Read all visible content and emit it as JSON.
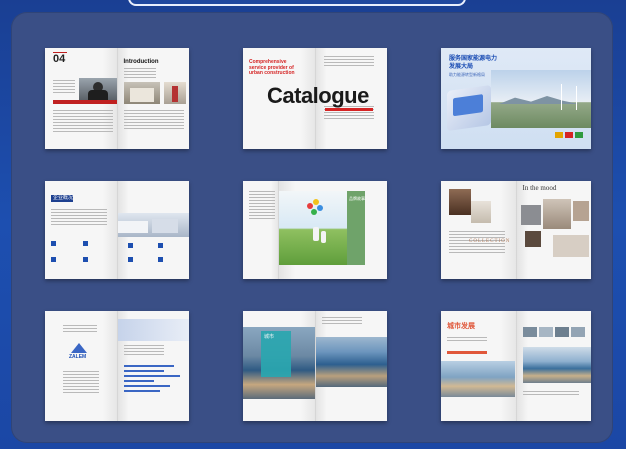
{
  "books": [
    {
      "id": "intro",
      "chapter_number": "04",
      "title": "Introduction"
    },
    {
      "id": "catalogue",
      "tagline": "Comprehensive service provider of urban construction",
      "title": "Catalogue"
    },
    {
      "id": "energy",
      "title_line1": "服务国家能源电力",
      "title_line2": "发展大局",
      "subtitle": "助力能源转型新格局"
    },
    {
      "id": "corporate",
      "label": "企业概况"
    },
    {
      "id": "balloons",
      "label": "品牌故事"
    },
    {
      "id": "mood",
      "title": "In the mood",
      "collection": "COLLECTION"
    },
    {
      "id": "data-report",
      "brand": "ZALEM"
    },
    {
      "id": "city-aerial",
      "label": "城市"
    },
    {
      "id": "city-report",
      "label": "城市发展"
    }
  ],
  "colors": {
    "background": "#1d4fb0",
    "panel": "#3a4f86",
    "accent_red": "#d52424",
    "accent_blue": "#1b4db4",
    "accent_green": "#6fa36a",
    "accent_orange": "#e0573a"
  }
}
